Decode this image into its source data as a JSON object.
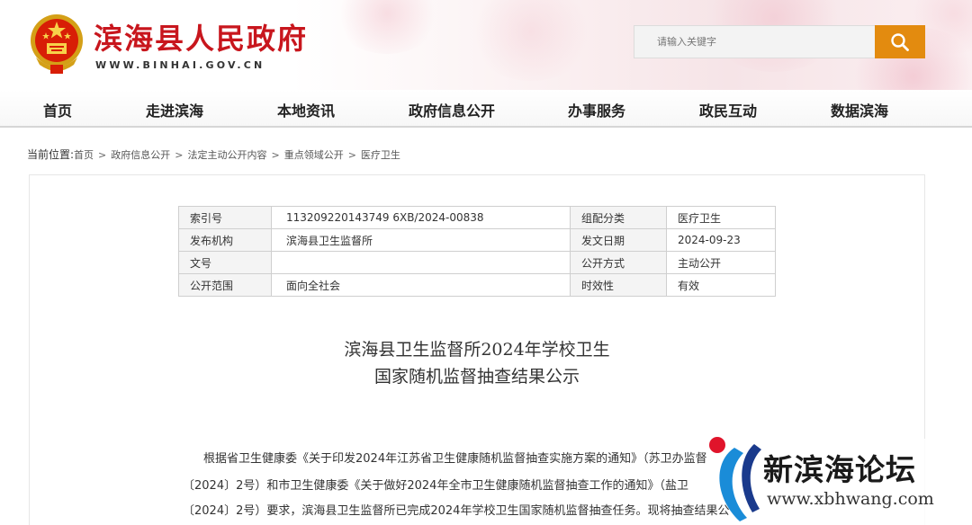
{
  "header": {
    "site_title": "滨海县人民政府",
    "site_url": "WWW.BINHAI.GOV.CN",
    "search_placeholder": "请输入关键字"
  },
  "nav": {
    "items": [
      "首页",
      "走进滨海",
      "本地资讯",
      "政府信息公开",
      "办事服务",
      "政民互动",
      "数据滨海"
    ]
  },
  "breadcrumb": {
    "lead": "当前位置:",
    "items": [
      "首页",
      "政府信息公开",
      "法定主动公开内容",
      "重点领域公开",
      "医疗卫生"
    ],
    "separator": ">"
  },
  "meta": {
    "rows": [
      {
        "label1": "索引号",
        "value1": "113209220143749 6XB/2024-00838",
        "label2": "组配分类",
        "value2": "医疗卫生"
      },
      {
        "label1": "发布机构",
        "value1": "滨海县卫生监督所",
        "label2": "发文日期",
        "value2": "2024-09-23"
      },
      {
        "label1": "文号",
        "value1": "",
        "label2": "公开方式",
        "value2": "主动公开"
      },
      {
        "label1": "公开范围",
        "value1": "面向全社会",
        "label2": "时效性",
        "value2": "有效"
      }
    ]
  },
  "article": {
    "title_line1": "滨海县卫生监督所2024年学校卫生",
    "title_line2": "国家随机监督抽查结果公示",
    "body_lines": [
      "根据省卫生健康委《关于印发2024年江苏省卫生健康随机监督抽查实施方案的通知》（苏卫办监督",
      "〔2024〕2号）和市卫生健康委《关于做好2024年全市卫生健康随机监督抽查工作的通知》（盐卫",
      "〔2024〕2号）要求，滨海县卫生监督所已完成2024年学校卫生国家随机监督抽查任务。现将抽查结果公"
    ]
  },
  "watermark": {
    "text": "新滨海论坛",
    "url": "www.xbhwang.com"
  },
  "colors": {
    "brand_red": "#c8161d",
    "search_orange": "#e38b0f"
  }
}
